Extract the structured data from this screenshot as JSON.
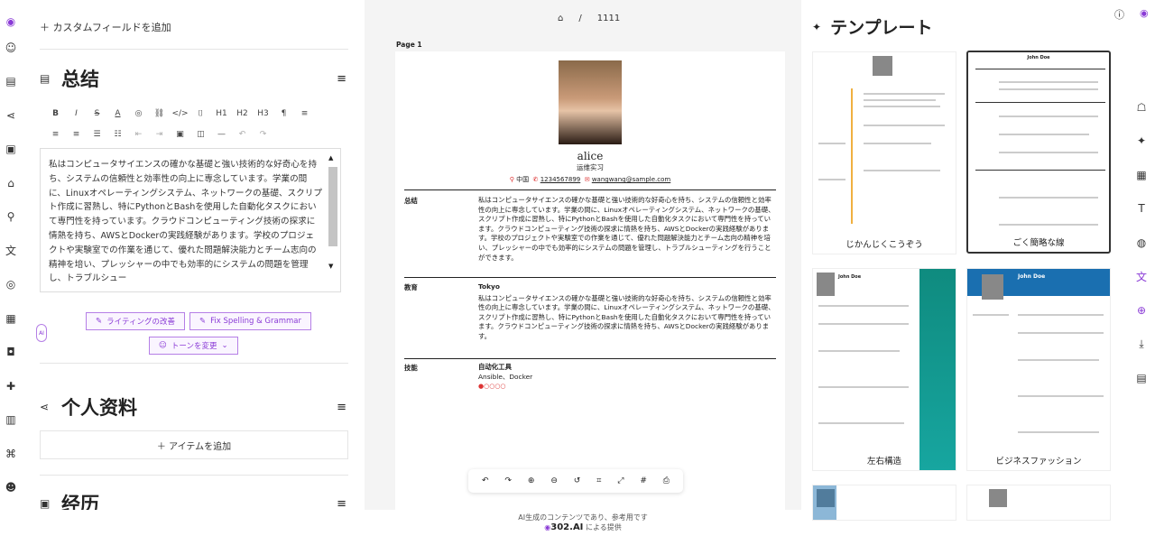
{
  "left_sidebar": {
    "icons": [
      "logo-icon",
      "profile-icon",
      "card-icon",
      "share-icon",
      "briefcase-icon",
      "graduation-icon",
      "person-icon",
      "translate-icon",
      "award-icon",
      "certificate-icon",
      "gamepad-icon",
      "puzzle-icon",
      "book-icon",
      "handshake-icon",
      "group-icon"
    ]
  },
  "editor": {
    "add_custom_field": "カスタムフィールドを追加",
    "summary": {
      "title": "总结",
      "toolbar": [
        "B",
        "I",
        "S",
        "A",
        "◎",
        "🔗",
        "</>",
        "⌁",
        "H1",
        "H2",
        "H3",
        "¶",
        "≡",
        "≡",
        "≡",
        "•",
        "1.",
        "⇤",
        "⇥",
        "▣",
        "◫",
        "—",
        "↶",
        "↷"
      ],
      "text": "私はコンピュータサイエンスの確かな基礎と強い技術的な好奇心を持ち、システムの信頼性と効率性の向上に専念しています。学業の間に、Linuxオペレーティングシステム、ネットワークの基礎、スクリプト作成に習熟し、特にPythonとBashを使用した自動化タスクにおいて専門性を持っています。クラウドコンピューティング技術の探求に情熱を持ち、AWSとDockerの実践経験があります。学校のプロジェクトや実験室での作業を通じて、優れた問題解決能力とチーム志向の精神を培い、プレッシャーの中でも効率的にシステムの問題を管理し、トラブルシュー",
      "ai_buttons": {
        "improve": "ライティングの改善",
        "fix": "Fix Spelling & Grammar",
        "tone": "トーンを変更"
      },
      "ai_badge": "AI"
    },
    "profile": {
      "title": "个人资料",
      "add_item": "アイテムを追加"
    },
    "experience": {
      "title": "经历"
    }
  },
  "preview": {
    "breadcrumb": {
      "title": "1111"
    },
    "page_label": "Page 1",
    "resume": {
      "name": "alice",
      "job": "运维实习",
      "location": "中国",
      "phone": "1234567899",
      "email": "wangwang@sample.com",
      "sections": [
        {
          "label": "总结",
          "heading": "",
          "text": "私はコンピュータサイエンスの確かな基礎と強い技術的な好奇心を持ち、システムの信頼性と効率性の向上に専念しています。学業の間に、Linuxオペレーティングシステム、ネットワークの基礎、スクリプト作成に習熟し、特にPythonとBashを使用した自動化タスクにおいて専門性を持っています。クラウドコンピューティング技術の探求に情熱を持ち、AWSとDockerの実践経験があります。学校のプロジェクトや実験室での作業を通じて、優れた問題解決能力とチーム志向の精神を培い、プレッシャーの中でも効率的にシステムの問題を管理し、トラブルシューティングを行うことができます。"
        },
        {
          "label": "教育",
          "heading": "Tokyo",
          "text": "私はコンピュータサイエンスの確かな基礎と強い技術的な好奇心を持ち、システムの信頼性と効率性の向上に専念しています。学業の間に、Linuxオペレーティングシステム、ネットワークの基礎、スクリプト作成に習熟し、特にPythonとBashを使用した自動化タスクにおいて専門性を持っています。クラウドコンピューティング技術の探求に情熱を持ち、AWSとDockerの実践経験があります。"
        },
        {
          "label": "技能",
          "heading": "自动化工具",
          "text": "Ansible、Docker"
        }
      ],
      "skill_level": 1,
      "skill_max": 5
    },
    "footer": {
      "line1": "AI生成のコンテンツであり、参考用です",
      "brand": "302.AI",
      "suffix": "による提供"
    }
  },
  "templates": {
    "title": "テンプレート",
    "items": [
      {
        "name": "じかんじくこうぞう"
      },
      {
        "name": "ごく簡略な線"
      },
      {
        "name": "左右構造"
      },
      {
        "name": "ビジネスファッション"
      }
    ],
    "card_person": "John Doe"
  },
  "right_sidebar": {
    "icons": [
      "robot-icon",
      "layers-icon",
      "layout-icon",
      "typography-icon",
      "palette-icon",
      "translate-icon",
      "globe-icon",
      "download-icon",
      "notes-icon"
    ]
  },
  "colors": {
    "accent": "#8a3bd6",
    "teal": "#0f8b7f",
    "brand_blue": "#1a6fb0"
  }
}
